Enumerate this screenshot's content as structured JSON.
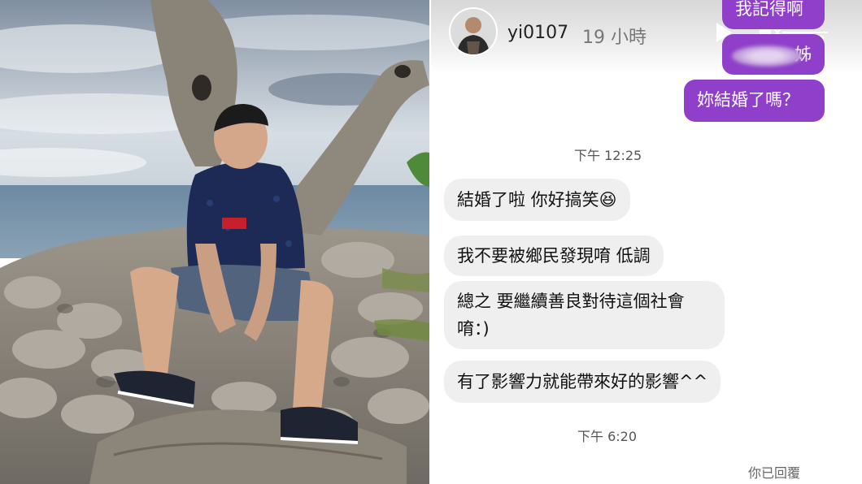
{
  "story": {
    "username": "yi0107",
    "time_ago": "19 小時",
    "play_icon": "play-icon",
    "mute_icon": "speaker-muted-icon",
    "more_icon": "more-dots-icon"
  },
  "messages_outgoing": {
    "msg1": "我記得啊",
    "msg2": "姊",
    "msg3": "妳結婚了嗎？"
  },
  "timestamps": {
    "first": "下午 12:25",
    "second": "下午 6:20"
  },
  "messages_incoming": {
    "msg1": "結婚了啦 你好搞笑😆",
    "msg2": "我不要被鄉民發現唷 低調",
    "msg3_line1": "總之 要繼續善良對待這個社會",
    "msg3_line2": "唷：)",
    "msg4": "有了影響力就能帶來好的影響^^"
  },
  "status": {
    "replied": "你已回覆"
  },
  "colors": {
    "outgoing_bubble": "#8f3fc9",
    "incoming_bubble": "#efefef"
  }
}
